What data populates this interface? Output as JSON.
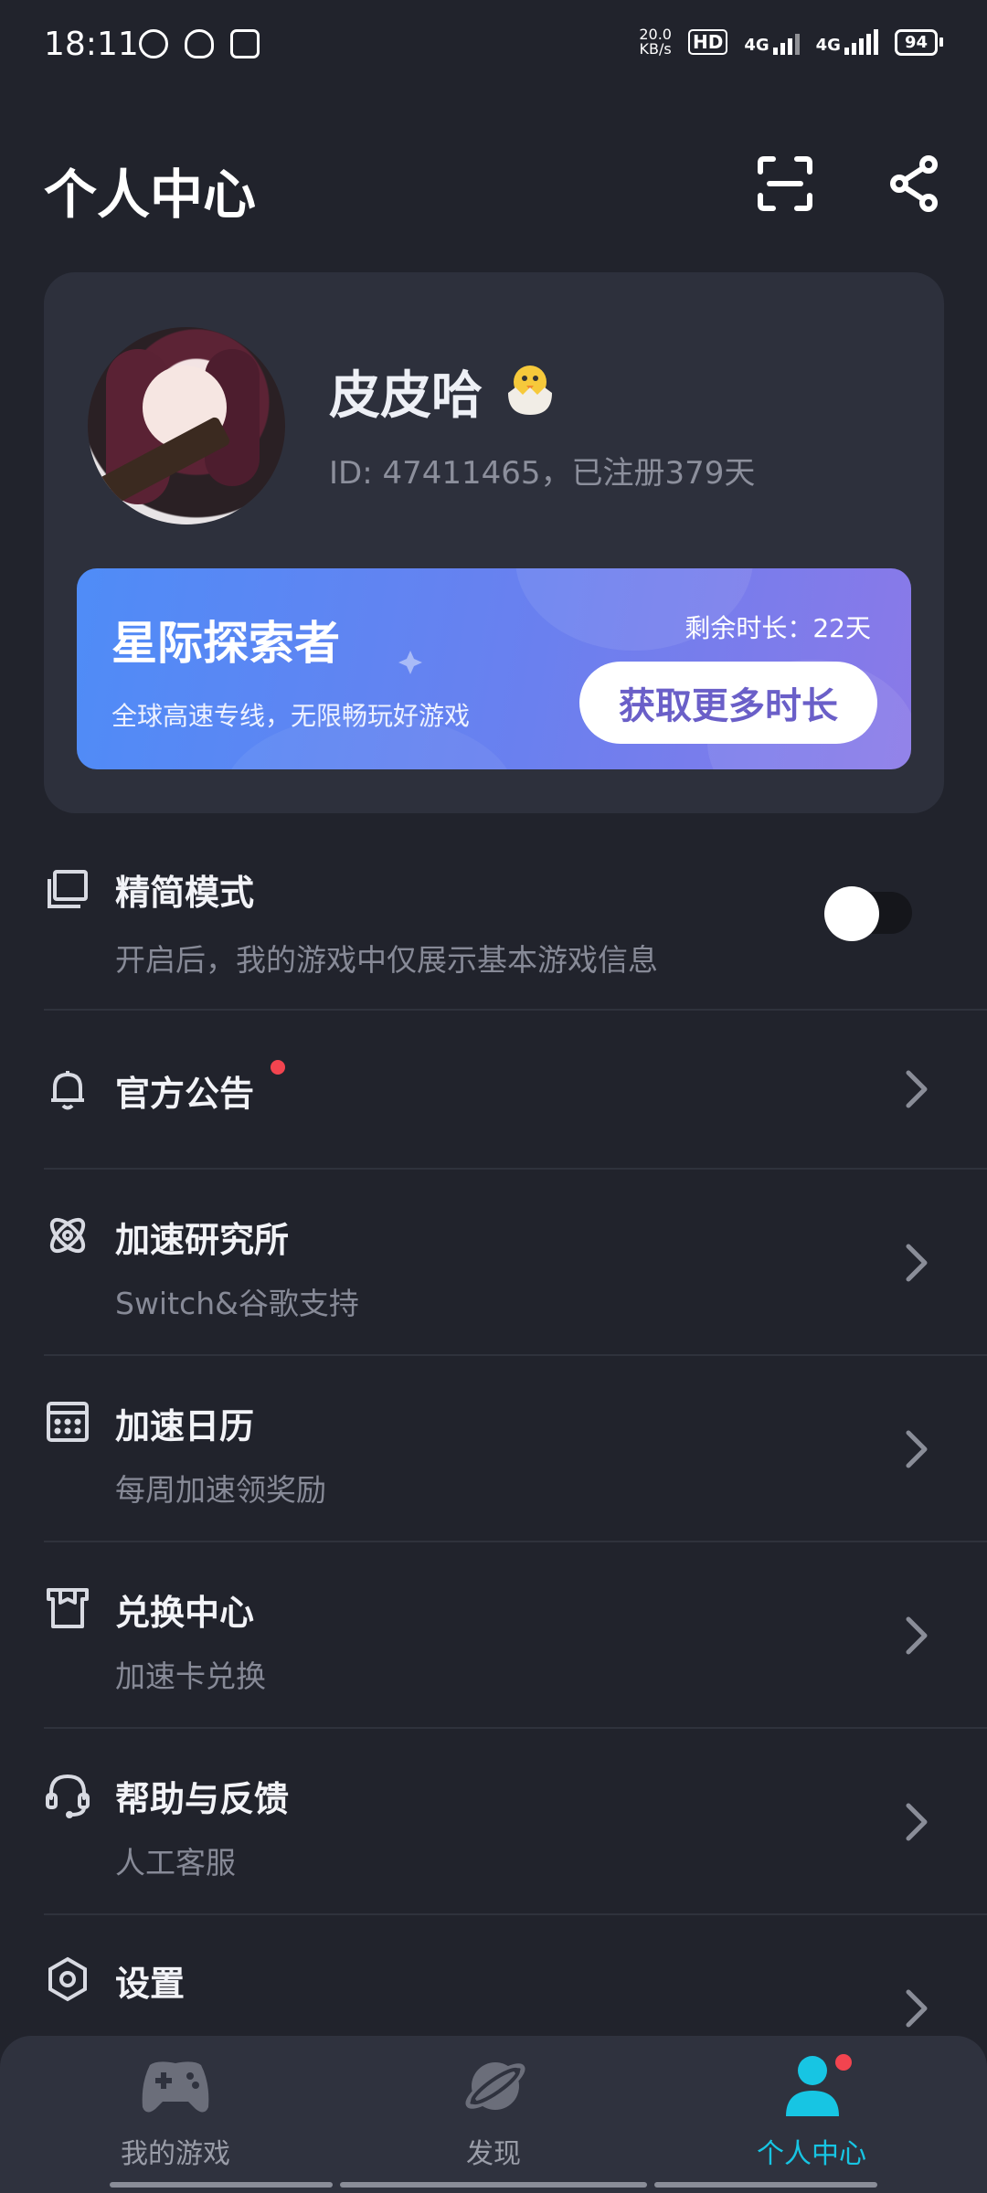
{
  "status_bar": {
    "time": "18:11",
    "net_speed_value": "20.0",
    "net_speed_unit": "KB/s",
    "hd": "HD",
    "sim1": "4G",
    "sim2": "4G",
    "battery": "94"
  },
  "header": {
    "title": "个人中心",
    "scan_icon": "scan-icon",
    "share_icon": "share-icon"
  },
  "profile": {
    "username": "皮皮哈",
    "id_text": "ID: 47411465，已注册379天"
  },
  "membership": {
    "tier_name": "星际探索者",
    "description": "全球高速专线，无限畅玩好游戏",
    "remaining": "剩余时长：22天",
    "cta": "获取更多时长"
  },
  "menu": [
    {
      "title": "精简模式",
      "subtitle": "开启后，我的游戏中仅展示基本游戏信息",
      "icon": "compact-mode-icon",
      "toggle_on": false
    },
    {
      "title": "官方公告",
      "subtitle": "",
      "icon": "bell-icon",
      "badge": true
    },
    {
      "title": "加速研究所",
      "subtitle": "Switch&谷歌支持",
      "icon": "atom-icon"
    },
    {
      "title": "加速日历",
      "subtitle": "每周加速领奖励",
      "icon": "calendar-icon"
    },
    {
      "title": "兑换中心",
      "subtitle": "加速卡兑换",
      "icon": "gift-box-icon"
    },
    {
      "title": "帮助与反馈",
      "subtitle": "人工客服",
      "icon": "headset-icon"
    },
    {
      "title": "设置",
      "subtitle": "",
      "icon": "settings-icon"
    }
  ],
  "bottom_nav": {
    "items": [
      {
        "label": "我的游戏",
        "icon": "gamepad-icon",
        "active": false
      },
      {
        "label": "发现",
        "icon": "planet-icon",
        "active": false
      },
      {
        "label": "个人中心",
        "icon": "person-icon",
        "active": true
      }
    ],
    "active_color": "#17c5e3",
    "inactive_color": "#9a9da8"
  },
  "colors": {
    "background": "#21232c",
    "card": "#2d303c",
    "accent": "#17c5e3",
    "badge": "#f2444f"
  }
}
